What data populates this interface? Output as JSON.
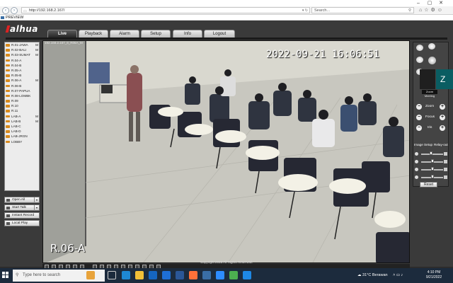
{
  "browser": {
    "url": "http://192.168.2.167/",
    "search_placeholder": "Search...",
    "tab_title": "PREVIEW"
  },
  "app": {
    "logo": "alhua",
    "menu": [
      "Live",
      "Playback",
      "Alarm",
      "Setup",
      "Info",
      "Logout"
    ],
    "active_menu": "Live"
  },
  "channels": [
    {
      "label": "R.01-JAWA",
      "m": "M"
    },
    {
      "label": "R.02-BALI",
      "m": "M"
    },
    {
      "label": "R.03-SUMAT",
      "m": "M"
    },
    {
      "label": "R.04-A",
      "m": ""
    },
    {
      "label": "R.04-B",
      "m": ""
    },
    {
      "label": "R.05-A",
      "m": ""
    },
    {
      "label": "R.05-B",
      "m": ""
    },
    {
      "label": "R.06-A",
      "m": "M"
    },
    {
      "label": "R.06-B",
      "m": ""
    },
    {
      "label": "R.07-PAPUA",
      "m": ""
    },
    {
      "label": "R.08-LOMBK",
      "m": ""
    },
    {
      "label": "R.09",
      "m": ""
    },
    {
      "label": "R.10",
      "m": ""
    },
    {
      "label": "R.11",
      "m": ""
    },
    {
      "label": "LAB-A",
      "m": "M"
    },
    {
      "label": "LAB-B",
      "m": "M"
    },
    {
      "label": "LAB-C",
      "m": ""
    },
    {
      "label": "LAB-D",
      "m": ""
    },
    {
      "label": "LAB-JRGN",
      "m": ""
    },
    {
      "label": "LOBBY",
      "m": ""
    }
  ],
  "left_buttons": [
    "Open All",
    "Start Talk",
    "Instant Record",
    "Local Play"
  ],
  "video": {
    "osd_top": "192.168.2.167_8_R06A_M",
    "timestamp": "2022-09-21  16:06:51",
    "channel_name": "R.06-A"
  },
  "ptz": {
    "zoom": "Zoom",
    "focus": "Focus",
    "iris": "Iris",
    "image_setup": "Image Setup",
    "relay_out": "Relay-out",
    "reset": "Reset",
    "sliders": [
      0.45,
      0.5,
      0.5,
      0.5
    ]
  },
  "meeting": {
    "initial": "Z",
    "name_tag": "Zoom Meeting"
  },
  "footer": {
    "copyright": "Copyright 2015 All Rights Reserved."
  },
  "taskbar": {
    "search_placeholder": "Type here to search",
    "weather": "31°C  Berawan",
    "time": "4:10 PM",
    "date": "9/21/2022"
  }
}
